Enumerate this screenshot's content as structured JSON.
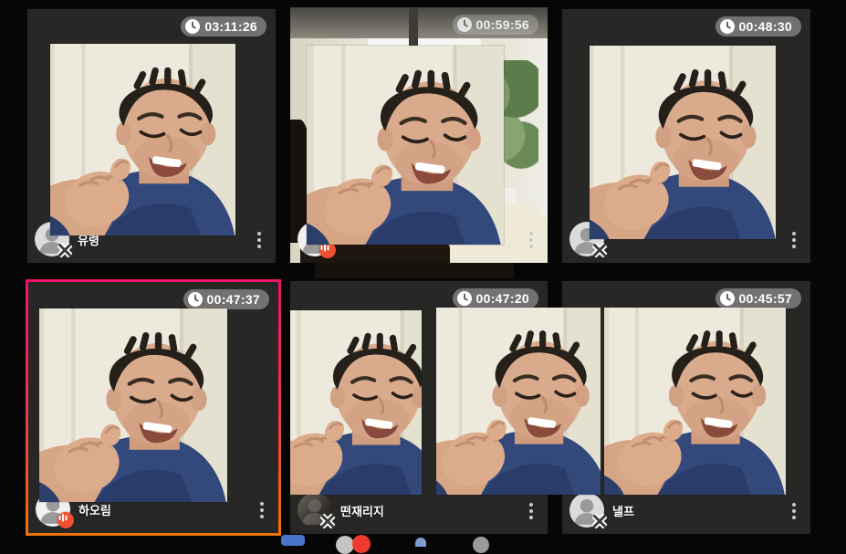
{
  "screen": {
    "background": "#060606",
    "tile_background": "#272726",
    "selection_border_top_color": "#f1116d",
    "selection_border_bottom_color": "#ef7209",
    "timer_badge_background": "rgba(128,128,128,0.85)",
    "speaker_badge_color": "#f1502e"
  },
  "tiles": [
    {
      "position": "top-left",
      "timer": "03:11:26",
      "name": "유령",
      "mic_state": "muted",
      "selected": false
    },
    {
      "position": "top-middle",
      "timer": "00:59:56",
      "name": "",
      "mic_state": "speaking",
      "selected": false
    },
    {
      "position": "top-right",
      "timer": "00:48:30",
      "name": "",
      "mic_state": "muted",
      "selected": false
    },
    {
      "position": "bottom-left",
      "timer": "00:47:37",
      "name": "하오림",
      "mic_state": "speaking",
      "selected": true
    },
    {
      "position": "bottom-middle",
      "timer": "00:47:20",
      "name": "떤재리지",
      "mic_state": "muted",
      "selected": false
    },
    {
      "position": "bottom-right",
      "timer": "00:45:57",
      "name": "낼프",
      "mic_state": "muted",
      "selected": false
    }
  ],
  "icons": {
    "timer": "clock-icon",
    "menu": "kebab-menu-icon",
    "muted": "mic-muted-x-icon",
    "speaking": "volume-bars-icon",
    "avatar": "person-silhouette-icon"
  },
  "bottom_edge": {
    "badge_count": ""
  }
}
